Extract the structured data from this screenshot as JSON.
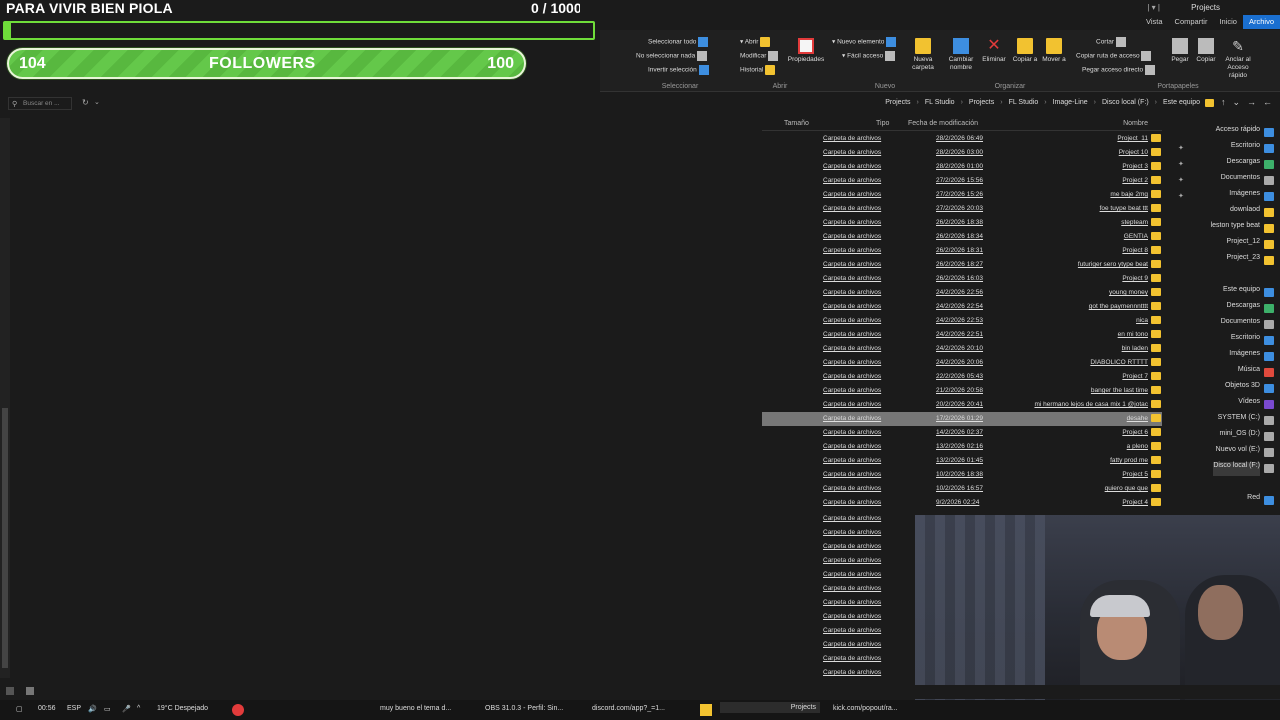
{
  "overlay": {
    "title": "PARA VIVIR BIEN PIOLA",
    "counter": "0 / 1000",
    "followers_label": "FOLLOWERS",
    "followers_current": "104",
    "followers_goal": "100",
    "progress_fraction": 0.0
  },
  "window": {
    "title": "Projects",
    "quick_access": "| ▾ |"
  },
  "ribbon_tabs": [
    "Archivo",
    "Inicio",
    "Compartir",
    "Vista"
  ],
  "ribbon": {
    "groups": {
      "portapapeles": "Portapapeles",
      "organizar": "Organizar",
      "nuevo": "Nuevo",
      "abrir": "Abrir",
      "seleccionar": "Seleccionar"
    },
    "buttons": {
      "anclar": "Anclar al Acceso rápido",
      "copiar": "Copiar",
      "pegar": "Pegar",
      "cortar": "Cortar",
      "copiar_ruta": "Copiar ruta de acceso",
      "pegar_acceso": "Pegar acceso directo",
      "mover_a": "Mover a",
      "copiar_a": "Copiar a",
      "eliminar": "Eliminar",
      "cambiar_nombre": "Cambiar nombre",
      "nueva_carpeta": "Nueva carpeta",
      "nuevo_elemento": "Nuevo elemento",
      "facil_acceso": "Fácil acceso",
      "propiedades": "Propiedades",
      "abrir": "Abrir",
      "modificar": "Modificar",
      "historial": "Historial",
      "seleccionar_todo": "Seleccionar todo",
      "no_seleccionar": "No seleccionar nada",
      "invertir": "Invertir selección"
    }
  },
  "address": {
    "search_placeholder": "Buscar en ...",
    "breadcrumb": [
      "Este equipo",
      "Disco local (F:)",
      "Image-Line",
      "FL Studio",
      "Projects",
      "FL Studio",
      "Projects"
    ]
  },
  "columns": {
    "name": "Nombre",
    "date": "Fecha de modificación",
    "type": "Tipo",
    "size": "Tamaño"
  },
  "files": [
    {
      "name": "Project_11",
      "date": "28/2/2026 06:49",
      "type": "Carpeta de archivos"
    },
    {
      "name": "Project 10",
      "date": "28/2/2026 03:00",
      "type": "Carpeta de archivos"
    },
    {
      "name": "Project 3",
      "date": "28/2/2026 01:00",
      "type": "Carpeta de archivos"
    },
    {
      "name": "Project 2",
      "date": "27/2/2026 15:56",
      "type": "Carpeta de archivos"
    },
    {
      "name": "me baje 2mg",
      "date": "27/2/2026 15:26",
      "type": "Carpeta de archivos"
    },
    {
      "name": "foe tuype beat ttt",
      "date": "27/2/2026 20:03",
      "type": "Carpeta de archivos"
    },
    {
      "name": "stepteam",
      "date": "26/2/2026 18:38",
      "type": "Carpeta de archivos"
    },
    {
      "name": "GENTIA",
      "date": "26/2/2026 18:34",
      "type": "Carpeta de archivos"
    },
    {
      "name": "Project 8",
      "date": "26/2/2026 18:31",
      "type": "Carpeta de archivos"
    },
    {
      "name": "futuriger sero ytype beat",
      "date": "26/2/2026 18:27",
      "type": "Carpeta de archivos"
    },
    {
      "name": "Project 9",
      "date": "26/2/2026 16:03",
      "type": "Carpeta de archivos"
    },
    {
      "name": "young money",
      "date": "24/2/2026 22:56",
      "type": "Carpeta de archivos"
    },
    {
      "name": "got the paymennntttt",
      "date": "24/2/2026 22:54",
      "type": "Carpeta de archivos"
    },
    {
      "name": "nica",
      "date": "24/2/2026 22:53",
      "type": "Carpeta de archivos"
    },
    {
      "name": "en mi tono",
      "date": "24/2/2026 22:51",
      "type": "Carpeta de archivos"
    },
    {
      "name": "bin laden",
      "date": "24/2/2026 20:10",
      "type": "Carpeta de archivos"
    },
    {
      "name": "DIABOLICO RTTTT",
      "date": "24/2/2026 20:06",
      "type": "Carpeta de archivos"
    },
    {
      "name": "Project 7",
      "date": "22/2/2026 05:43",
      "type": "Carpeta de archivos"
    },
    {
      "name": "banger the last time",
      "date": "21/2/2026 20:58",
      "type": "Carpeta de archivos"
    },
    {
      "name": "mi hermano lejos de casa mix 1 @jotac",
      "date": "20/2/2026 20:41",
      "type": "Carpeta de archivos"
    },
    {
      "name": "desahe",
      "date": "17/2/2026 01:29",
      "type": "Carpeta de archivos",
      "selected": true
    },
    {
      "name": "Project 6",
      "date": "14/2/2026 02:37",
      "type": "Carpeta de archivos"
    },
    {
      "name": "a pleno",
      "date": "13/2/2026 02:16",
      "type": "Carpeta de archivos"
    },
    {
      "name": "fatty prod me",
      "date": "13/2/2026 01:45",
      "type": "Carpeta de archivos"
    },
    {
      "name": "Project 5",
      "date": "10/2/2026 18:38",
      "type": "Carpeta de archivos"
    },
    {
      "name": "quiero que que",
      "date": "10/2/2026 16:57",
      "type": "Carpeta de archivos"
    },
    {
      "name": "Project 4",
      "date": "9/2/2026 02:24",
      "type": "Carpeta de archivos"
    }
  ],
  "extra_types": [
    "Carpeta de archivos",
    "Carpeta de archivos",
    "Carpeta de archivos",
    "Carpeta de archivos",
    "Carpeta de archivos",
    "Carpeta de archivos",
    "Carpeta de archivos",
    "Carpeta de archivos",
    "Carpeta de archivos",
    "Carpeta de archivos",
    "Carpeta de archivos",
    "Carpeta de archivos"
  ],
  "nav": [
    {
      "label": "Acceso rápido",
      "icon": "star-icon",
      "color": "#3d8ee0"
    },
    {
      "label": "Escritorio",
      "icon": "desktop-icon",
      "color": "#3d8ee0",
      "pin": true
    },
    {
      "label": "Descargas",
      "icon": "download-icon",
      "color": "#3db06a",
      "pin": true
    },
    {
      "label": "Documentos",
      "icon": "documents-icon",
      "color": "#aaaaaa",
      "pin": true
    },
    {
      "label": "Imágenes",
      "icon": "pictures-icon",
      "color": "#3d8ee0",
      "pin": true
    },
    {
      "label": "downlaod",
      "icon": "folder-icon",
      "color": "#f2c230"
    },
    {
      "label": "leston type beat",
      "icon": "folder-icon",
      "color": "#f2c230"
    },
    {
      "label": "Project_12",
      "icon": "folder-icon",
      "color": "#f2c230"
    },
    {
      "label": "Project_23",
      "icon": "folder-icon",
      "color": "#f2c230"
    },
    {
      "label": "",
      "icon": "",
      "color": ""
    },
    {
      "label": "Este equipo",
      "icon": "computer-icon",
      "color": "#3d8ee0"
    },
    {
      "label": "Descargas",
      "icon": "download-icon",
      "color": "#3db06a"
    },
    {
      "label": "Documentos",
      "icon": "documents-icon",
      "color": "#aaaaaa"
    },
    {
      "label": "Escritorio",
      "icon": "desktop-icon",
      "color": "#3d8ee0"
    },
    {
      "label": "Imágenes",
      "icon": "pictures-icon",
      "color": "#3d8ee0"
    },
    {
      "label": "Música",
      "icon": "music-icon",
      "color": "#e04a3d"
    },
    {
      "label": "Objetos 3D",
      "icon": "objects3d-icon",
      "color": "#3d8ee0"
    },
    {
      "label": "Vídeos",
      "icon": "videos-icon",
      "color": "#7a4ad0"
    },
    {
      "label": "SYSTEM (C:)",
      "icon": "drive-icon",
      "color": "#aaaaaa"
    },
    {
      "label": "mini_OS (D:)",
      "icon": "drive-icon",
      "color": "#aaaaaa"
    },
    {
      "label": "Nuevo vol (E:)",
      "icon": "drive-icon",
      "color": "#aaaaaa"
    },
    {
      "label": "Disco local (F:)",
      "icon": "drive-icon",
      "color": "#aaaaaa",
      "active": true
    },
    {
      "label": "",
      "icon": "",
      "color": ""
    },
    {
      "label": "Red",
      "icon": "network-icon",
      "color": "#3d8ee0"
    }
  ],
  "taskbar": {
    "time": "00:56",
    "lang": "ESP",
    "weather": "19°C  Despejado",
    "items": [
      "kick.com/popout/ra...",
      "Projects",
      "discord.com/app?_=1...",
      "OBS 31.0.3 - Perfil: Sin...",
      "muy bueno el tema d..."
    ]
  }
}
